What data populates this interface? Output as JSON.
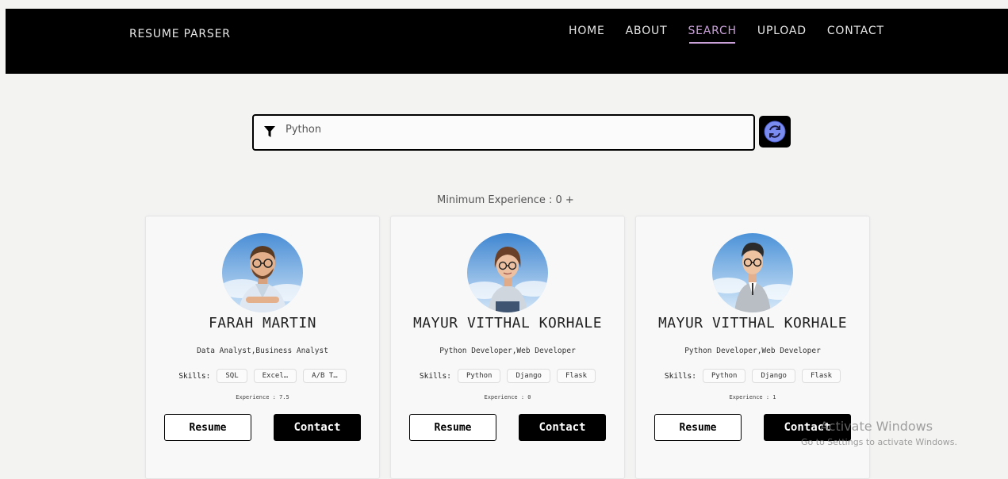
{
  "nav": {
    "brand": "RESUME PARSER",
    "links": [
      {
        "label": "HOME",
        "active": false
      },
      {
        "label": "ABOUT",
        "active": false
      },
      {
        "label": "SEARCH",
        "active": true
      },
      {
        "label": "UPLOAD",
        "active": false
      },
      {
        "label": "CONTACT",
        "active": false
      }
    ]
  },
  "search": {
    "value": "Python",
    "icon": "filter-icon",
    "refresh_icon": "refresh-icon"
  },
  "filter": {
    "min_experience_label": "Minimum Experience : 0 +"
  },
  "cards": [
    {
      "name": "FARAH MARTIN",
      "roles": "Data Analyst,Business Analyst",
      "skills_label": "Skills:",
      "skills": [
        "SQL",
        "Excel…",
        "A/B T…"
      ],
      "experience": "Experience : 7.5",
      "resume_label": "Resume",
      "contact_label": "Contact"
    },
    {
      "name": "MAYUR VITTHAL KORHALE",
      "roles": "Python Developer,Web Developer",
      "skills_label": "Skills:",
      "skills": [
        "Python",
        "Django",
        "Flask"
      ],
      "experience": "Experience : 0",
      "resume_label": "Resume",
      "contact_label": "Contact"
    },
    {
      "name": "MAYUR VITTHAL KORHALE",
      "roles": "Python Developer,Web Developer",
      "skills_label": "Skills:",
      "skills": [
        "Python",
        "Django",
        "Flask"
      ],
      "experience": "Experience : 1",
      "resume_label": "Resume",
      "contact_label": "Contact"
    }
  ],
  "watermark": {
    "line1": "Activate Windows",
    "line2": "Go to Settings to activate Windows."
  },
  "colors": {
    "nav_bg": "#000000",
    "active_link": "#c9a0d8",
    "page_bg": "#f3f3f2",
    "refresh_icon": "#7b8cf0"
  }
}
